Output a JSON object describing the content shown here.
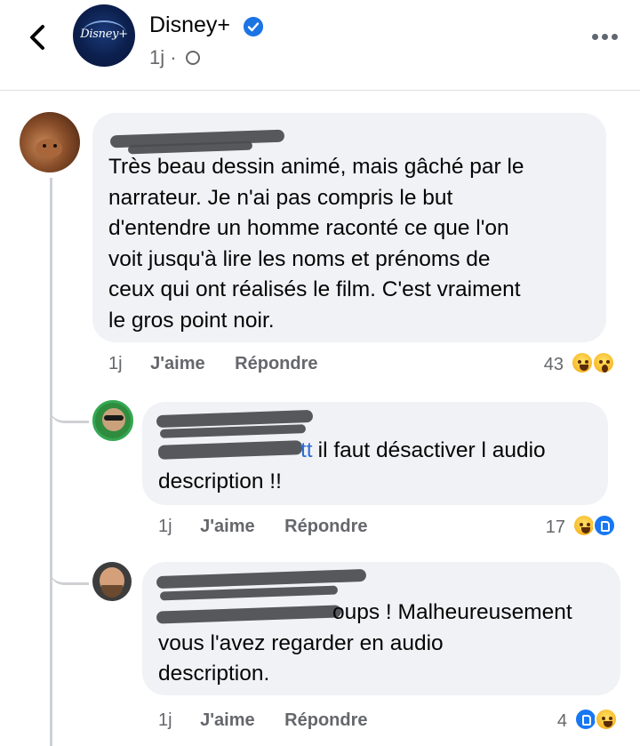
{
  "header": {
    "page_name": "Disney+",
    "page_time": "1j",
    "dot": "·",
    "logo_text": "Disney+"
  },
  "comments": [
    {
      "text_lines": [
        "Très beau dessin animé, mais gâché par le",
        "narrateur. Je n'ai pas compris le but",
        "d'entendre un homme raconté ce que l'on",
        "voit jusqu'à lire les noms et prénoms de",
        "ceux qui ont réalisés le film. C'est vraiment",
        "le gros point noir."
      ],
      "time": "1j",
      "like_label": "J'aime",
      "reply_label": "Répondre",
      "reaction_count": "43",
      "reactions": [
        "haha",
        "wow"
      ]
    },
    {
      "mention_suffix": "tt",
      "text_lines": [
        "il faut désactiver l audio",
        "description !!"
      ],
      "time": "1j",
      "like_label": "J'aime",
      "reply_label": "Répondre",
      "reaction_count": "17",
      "reactions": [
        "haha",
        "like"
      ]
    },
    {
      "text_lines": [
        "oups ! Malheureusement",
        "vous l'avez regarder en audio",
        "description."
      ],
      "time": "1j",
      "like_label": "J'aime",
      "reply_label": "Répondre",
      "reaction_count": "4",
      "reactions": [
        "like",
        "haha"
      ]
    }
  ],
  "colors": {
    "bubble": "#f0f2f5",
    "meta_text": "#65676b",
    "verified": "#1b74e4",
    "like_blue": "#1877f2"
  }
}
